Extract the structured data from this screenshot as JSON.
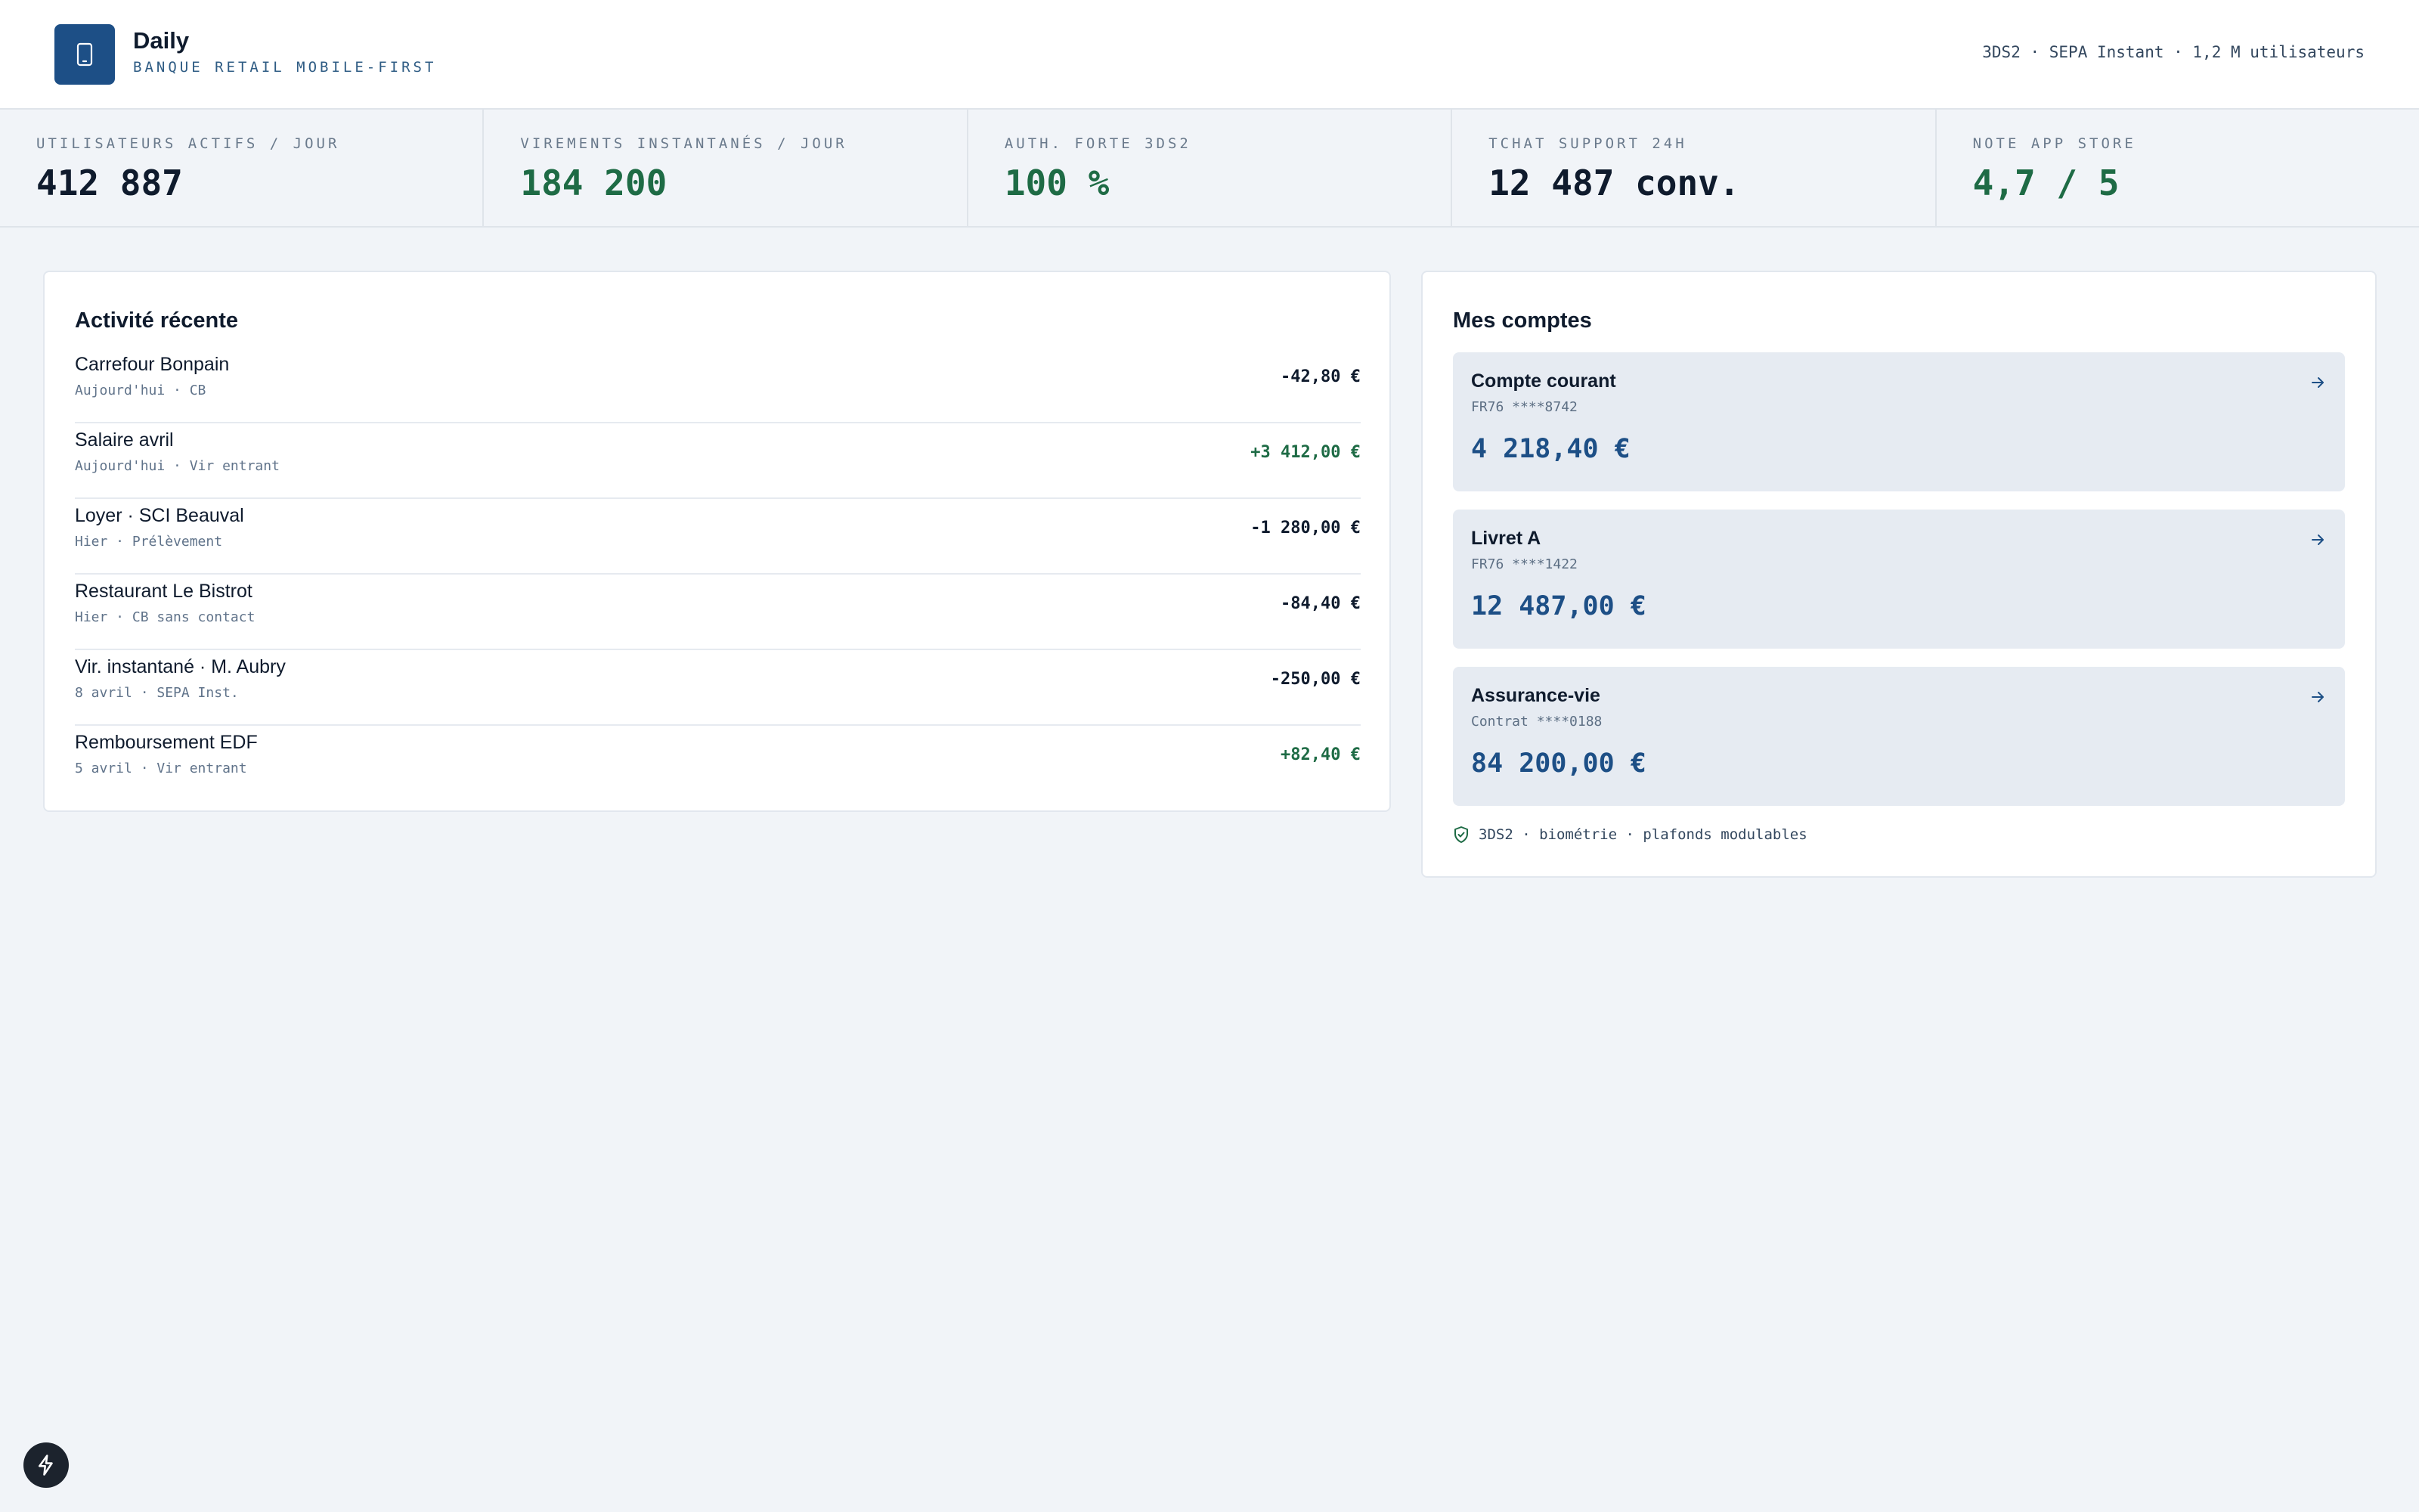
{
  "header": {
    "title": "Daily",
    "subtitle": "BANQUE RETAIL MOBILE-FIRST",
    "meta": "3DS2 · SEPA Instant · 1,2 M utilisateurs",
    "logo_icon": "smartphone-icon"
  },
  "kpis": [
    {
      "label": "UTILISATEURS ACTIFS / JOUR",
      "value": "412 887",
      "color": "#0f1b2d"
    },
    {
      "label": "VIREMENTS INSTANTANÉS / JOUR",
      "value": "184 200",
      "color": "#1e6b45"
    },
    {
      "label": "AUTH. FORTE 3DS2",
      "value": "100 %",
      "color": "#1e6b45"
    },
    {
      "label": "TCHAT SUPPORT 24H",
      "value": "12 487 conv.",
      "color": "#0f1b2d"
    },
    {
      "label": "NOTE APP STORE",
      "value": "4,7 / 5",
      "color": "#1e6b45"
    }
  ],
  "activity": {
    "title": "Activité récente",
    "items": [
      {
        "name": "Carrefour Bonpain",
        "sub": "Aujourd'hui · CB",
        "amount": "-42,80 €",
        "positive": false
      },
      {
        "name": "Salaire avril",
        "sub": "Aujourd'hui · Vir entrant",
        "amount": "+3 412,00 €",
        "positive": true
      },
      {
        "name": "Loyer · SCI Beauval",
        "sub": "Hier · Prélèvement",
        "amount": "-1 280,00 €",
        "positive": false
      },
      {
        "name": "Restaurant Le Bistrot",
        "sub": "Hier · CB sans contact",
        "amount": "-84,40 €",
        "positive": false
      },
      {
        "name": "Vir. instantané · M. Aubry",
        "sub": "8 avril · SEPA Inst.",
        "amount": "-250,00 €",
        "positive": false
      },
      {
        "name": "Remboursement EDF",
        "sub": "5 avril · Vir entrant",
        "amount": "+82,40 €",
        "positive": true
      }
    ]
  },
  "accounts": {
    "title": "Mes comptes",
    "items": [
      {
        "name": "Compte courant",
        "iban": "FR76 ****8742",
        "balance": "4 218,40 €"
      },
      {
        "name": "Livret A",
        "iban": "FR76 ****1422",
        "balance": "12 487,00 €"
      },
      {
        "name": "Assurance-vie",
        "iban": "Contrat ****0188",
        "balance": "84 200,00 €"
      }
    ],
    "security_note": "3DS2 · biométrie · plafonds modulables"
  },
  "colors": {
    "brand": "#1d4f86",
    "positive": "#1e6b45",
    "negative": "#0f1b2d"
  }
}
